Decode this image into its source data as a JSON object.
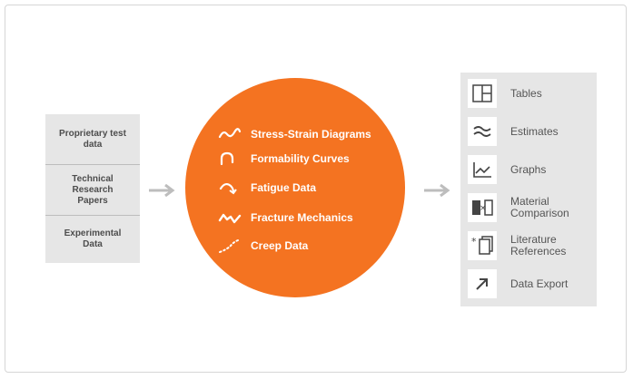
{
  "inputs": [
    {
      "label": "Proprietary test data"
    },
    {
      "label": "Technical Research Papers"
    },
    {
      "label": "Experimental Data"
    }
  ],
  "topics": [
    {
      "label": "Stress-Strain Diagrams",
      "icon": "wave-icon"
    },
    {
      "label": "Formability Curves",
      "icon": "curve-icon"
    },
    {
      "label": "Fatigue Data",
      "icon": "fatigue-arrow-icon"
    },
    {
      "label": "Fracture Mechanics",
      "icon": "fracture-icon"
    },
    {
      "label": "Creep Data",
      "icon": "dotted-curve-icon"
    }
  ],
  "outputs": [
    {
      "label": "Tables",
      "icon": "table-icon"
    },
    {
      "label": "Estimates",
      "icon": "approx-icon"
    },
    {
      "label": "Graphs",
      "icon": "graph-icon"
    },
    {
      "label": "Material Comparison",
      "icon": "comparison-icon"
    },
    {
      "label": "Literature References",
      "icon": "reference-icon"
    },
    {
      "label": "Data Export",
      "icon": "export-arrow-icon"
    }
  ],
  "colors": {
    "accent": "#f47321",
    "panel": "#e6e6e6",
    "text": "#555555",
    "arrow": "#bdbdbd"
  }
}
